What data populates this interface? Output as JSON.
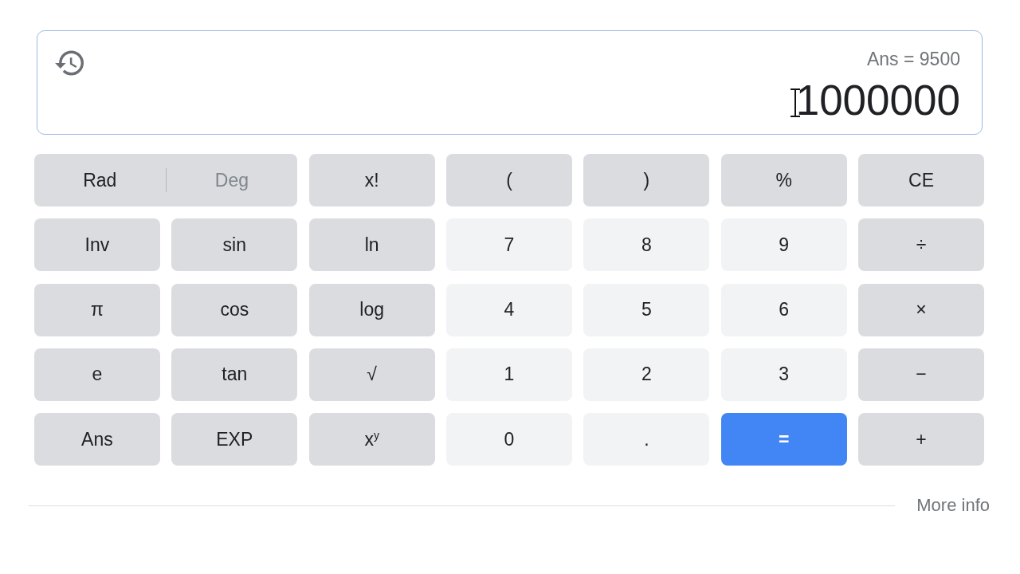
{
  "display": {
    "previous": "Ans = 9500",
    "value": "1000000"
  },
  "keypad": {
    "rows": [
      [
        {
          "kind": "angle",
          "label": "Rad",
          "selected": true
        },
        {
          "kind": "angle",
          "label": "Deg",
          "selected": false
        },
        {
          "kind": "function",
          "label": "x!"
        },
        {
          "kind": "function",
          "label": "("
        },
        {
          "kind": "function",
          "label": ")"
        },
        {
          "kind": "function",
          "label": "%"
        },
        {
          "kind": "function",
          "label": "CE"
        }
      ],
      [
        {
          "kind": "function",
          "label": "Inv"
        },
        {
          "kind": "function",
          "label": "sin"
        },
        {
          "kind": "function",
          "label": "ln"
        },
        {
          "kind": "digit",
          "label": "7"
        },
        {
          "kind": "digit",
          "label": "8"
        },
        {
          "kind": "digit",
          "label": "9"
        },
        {
          "kind": "function",
          "label": "÷"
        }
      ],
      [
        {
          "kind": "function",
          "label": "π"
        },
        {
          "kind": "function",
          "label": "cos"
        },
        {
          "kind": "function",
          "label": "log"
        },
        {
          "kind": "digit",
          "label": "4"
        },
        {
          "kind": "digit",
          "label": "5"
        },
        {
          "kind": "digit",
          "label": "6"
        },
        {
          "kind": "function",
          "label": "×"
        }
      ],
      [
        {
          "kind": "function",
          "label": "e"
        },
        {
          "kind": "function",
          "label": "tan"
        },
        {
          "kind": "function",
          "label": "√"
        },
        {
          "kind": "digit",
          "label": "1"
        },
        {
          "kind": "digit",
          "label": "2"
        },
        {
          "kind": "digit",
          "label": "3"
        },
        {
          "kind": "function",
          "label": "−"
        }
      ],
      [
        {
          "kind": "function",
          "label": "Ans"
        },
        {
          "kind": "function",
          "label": "EXP"
        },
        {
          "kind": "function",
          "label": "x$^{y}$"
        },
        {
          "kind": "digit",
          "label": "0"
        },
        {
          "kind": "digit",
          "label": "."
        },
        {
          "kind": "equals",
          "label": "="
        },
        {
          "kind": "function",
          "label": "+"
        }
      ]
    ]
  },
  "footer": {
    "link": "More info"
  }
}
